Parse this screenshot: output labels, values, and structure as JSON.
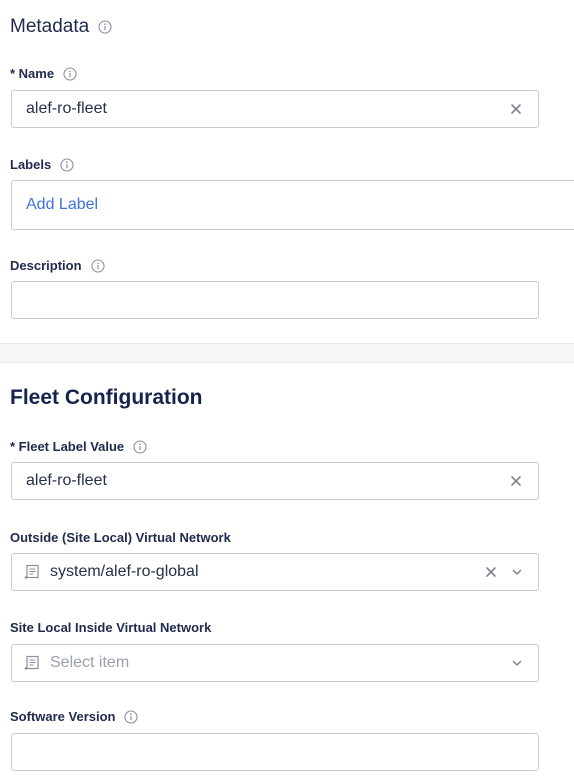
{
  "metadata": {
    "title": "Metadata",
    "name": {
      "label": "* Name",
      "value": "alef-ro-fleet"
    },
    "labels": {
      "label": "Labels",
      "add_label": "Add Label"
    },
    "description": {
      "label": "Description",
      "value": ""
    }
  },
  "fleet": {
    "title": "Fleet Configuration",
    "label_value": {
      "label": "* Fleet Label Value",
      "value": "alef-ro-fleet"
    },
    "outside_network": {
      "label": "Outside (Site Local) Virtual Network",
      "value": "system/alef-ro-global"
    },
    "inside_network": {
      "label": "Site Local Inside Virtual Network",
      "placeholder": "Select item"
    },
    "software_version": {
      "label": "Software Version",
      "value": ""
    }
  },
  "icons": {
    "info": "info-icon",
    "clear": "close-icon",
    "dropdown": "chevron-down-icon",
    "list": "list-icon"
  }
}
